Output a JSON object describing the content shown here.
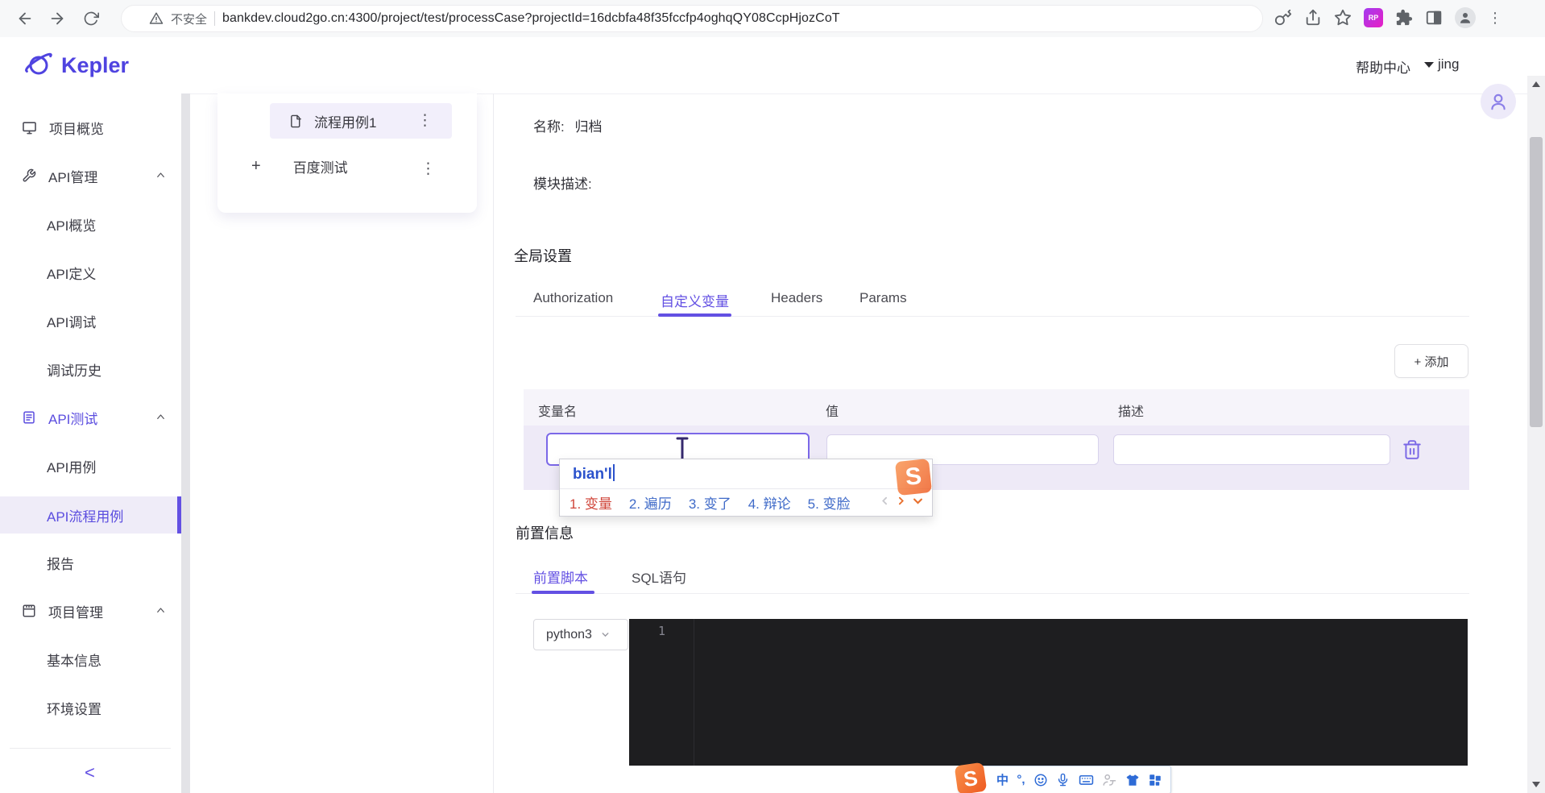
{
  "browser": {
    "security_warning": "不安全",
    "url": "bankdev.cloud2go.cn:4300/project/test/processCase?projectId=16dcbfa48f35fccfp4oghqQY08CcpHjozCoT",
    "extension_badge": "RP"
  },
  "header": {
    "logo_text": "Kepler",
    "help_center": "帮助中心",
    "username": "jing"
  },
  "sidebar": {
    "items": [
      {
        "label": "项目概览",
        "type": "section"
      },
      {
        "label": "API管理",
        "type": "section",
        "expanded": true
      },
      {
        "label": "API概览",
        "type": "sub"
      },
      {
        "label": "API定义",
        "type": "sub"
      },
      {
        "label": "API调试",
        "type": "sub"
      },
      {
        "label": "调试历史",
        "type": "sub"
      },
      {
        "label": "API测试",
        "type": "section",
        "expanded": true,
        "highlighted": true
      },
      {
        "label": "API用例",
        "type": "sub"
      },
      {
        "label": "API流程用例",
        "type": "sub",
        "active": true
      },
      {
        "label": "报告",
        "type": "sub"
      },
      {
        "label": "项目管理",
        "type": "section",
        "expanded": true
      },
      {
        "label": "基本信息",
        "type": "sub"
      },
      {
        "label": "环境设置",
        "type": "sub"
      }
    ],
    "collapse_label": "<"
  },
  "tree": {
    "items": [
      {
        "label": "流程用例1",
        "active": true,
        "menu_icon": "⋮"
      },
      {
        "label": "百度测试",
        "expander": "+",
        "menu_icon": "⋮"
      }
    ]
  },
  "main": {
    "name_label": "名称:",
    "name_value": "归档",
    "module_desc_label": "模块描述:",
    "global_settings_title": "全局设置",
    "tabs": [
      {
        "label": "Authorization"
      },
      {
        "label": "自定义变量",
        "active": true
      },
      {
        "label": "Headers"
      },
      {
        "label": "Params"
      }
    ],
    "add_button": "+ 添加",
    "table": {
      "headers": [
        "变量名",
        "值",
        "描述"
      ],
      "row": {
        "variable_value": "",
        "value_value": "",
        "desc_value": ""
      }
    },
    "pre_info_title": "前置信息",
    "pre_tabs": [
      {
        "label": "前置脚本",
        "active": true
      },
      {
        "label": "SQL语句"
      }
    ],
    "language_select": "python3",
    "editor_line_number": "1"
  },
  "ime": {
    "composition": "bian'l",
    "candidates": [
      "1. 变量",
      "2. 遍历",
      "3. 变了",
      "4. 辩论",
      "5. 变脸"
    ],
    "logo_letter": "S",
    "toolbar": {
      "mode": "中",
      "punct": "°,"
    }
  },
  "colors": {
    "accent_purple": "#6350e3",
    "active_item_bg": "#efecf8",
    "sogou_orange": "#f0652f",
    "ime_composition_blue": "#2b52cc",
    "ime_candidate_blue": "#3f6ac8",
    "ime_candidate_red": "#d0453a",
    "editor_bg": "#1e1e20"
  }
}
